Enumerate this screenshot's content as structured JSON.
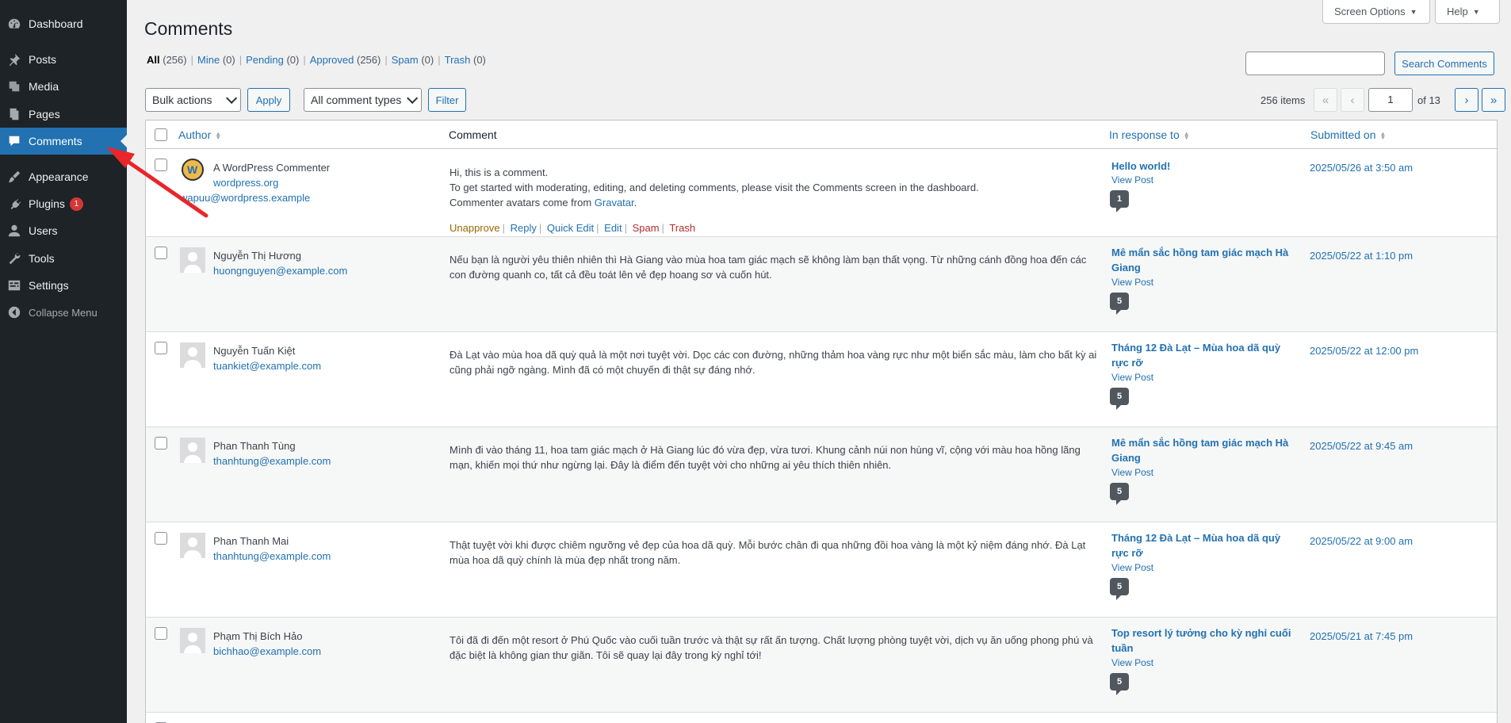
{
  "sidebar": {
    "items": [
      {
        "label": "Dashboard",
        "icon": "dashboard-icon"
      },
      {
        "label": "Posts",
        "icon": "pin-icon"
      },
      {
        "label": "Media",
        "icon": "media-icon"
      },
      {
        "label": "Pages",
        "icon": "pages-icon"
      },
      {
        "label": "Comments",
        "icon": "comment-bubble-icon",
        "active": true
      },
      {
        "label": "Appearance",
        "icon": "brush-icon"
      },
      {
        "label": "Plugins",
        "icon": "plug-icon",
        "badge": "1"
      },
      {
        "label": "Users",
        "icon": "user-icon"
      },
      {
        "label": "Tools",
        "icon": "wrench-icon"
      },
      {
        "label": "Settings",
        "icon": "settings-icon"
      },
      {
        "label": "Collapse Menu",
        "icon": "collapse-icon"
      }
    ]
  },
  "header": {
    "title": "Comments",
    "screen_options": "Screen Options",
    "help": "Help"
  },
  "filters": {
    "all_label": "All",
    "all_count": "(256)",
    "mine_label": "Mine",
    "mine_count": "(0)",
    "pending_label": "Pending",
    "pending_count": "(0)",
    "approved_label": "Approved",
    "approved_count": "(256)",
    "spam_label": "Spam",
    "spam_count": "(0)",
    "trash_label": "Trash",
    "trash_count": "(0)"
  },
  "search": {
    "value": "",
    "button": "Search Comments"
  },
  "bulk": {
    "selected": "Bulk actions",
    "apply": "Apply"
  },
  "types": {
    "selected": "All comment types",
    "filter": "Filter"
  },
  "pagination": {
    "items": "256 items",
    "first": "«",
    "prev": "‹",
    "next": "›",
    "last": "»",
    "current": "1",
    "of": "of 13"
  },
  "table": {
    "headers": {
      "author": "Author",
      "comment": "Comment",
      "response": "In response to",
      "submitted": "Submitted on"
    },
    "rows": [
      {
        "author": "A WordPress Commenter",
        "site": "wordpress.org",
        "email": "wapuu@wordpress.example",
        "lines": [
          "Hi, this is a comment.",
          "To get started with moderating, editing, and deleting comments, please visit the Comments screen in the dashboard."
        ],
        "line3_prefix": "Commenter avatars come from ",
        "line3_link": "Gravatar",
        "line3_suffix": ".",
        "actions": {
          "unapprove": "Unapprove",
          "reply": "Reply",
          "quick_edit": "Quick Edit",
          "edit": "Edit",
          "spam": "Spam",
          "trash": "Trash"
        },
        "response": "Hello world!",
        "view_post": "View Post",
        "count": "1",
        "submitted": "2025/05/26 at 3:50 am"
      },
      {
        "author": "Nguyễn Thị Hương",
        "email": "huongnguyen@example.com",
        "text": "Nếu bạn là người yêu thiên nhiên thì Hà Giang vào mùa hoa tam giác mạch sẽ không làm bạn thất vọng. Từ những cánh đồng hoa đến các con đường quanh co, tất cả đều toát lên vẻ đẹp hoang sơ và cuốn hút.",
        "response": "Mê mẩn sắc hồng tam giác mạch Hà Giang",
        "view_post": "View Post",
        "count": "5",
        "submitted": "2025/05/22 at 1:10 pm"
      },
      {
        "author": "Nguyễn Tuấn Kiệt",
        "email": "tuankiet@example.com",
        "text": "Đà Lạt vào mùa hoa dã quỳ quả là một nơi tuyệt vời. Dọc các con đường, những thảm hoa vàng rực như một biển sắc màu, làm cho bất kỳ ai cũng phải ngỡ ngàng. Mình đã có một chuyến đi thật sự đáng nhớ.",
        "response": "Tháng 12 Đà Lạt – Mùa hoa dã quỳ rực rỡ",
        "view_post": "View Post",
        "count": "5",
        "submitted": "2025/05/22 at 12:00 pm"
      },
      {
        "author": "Phan Thanh Tùng",
        "email": "thanhtung@example.com",
        "text": "Mình đi vào tháng 11, hoa tam giác mạch ở Hà Giang lúc đó vừa đẹp, vừa tươi. Khung cảnh núi non hùng vĩ, cộng với màu hoa hồng lãng mạn, khiến mọi thứ như ngừng lại. Đây là điểm đến tuyệt vời cho những ai yêu thích thiên nhiên.",
        "response": "Mê mẩn sắc hồng tam giác mạch Hà Giang",
        "view_post": "View Post",
        "count": "5",
        "submitted": "2025/05/22 at 9:45 am"
      },
      {
        "author": "Phan Thanh Mai",
        "email": "thanhtung@example.com",
        "text": "Thật tuyệt vời khi được chiêm ngưỡng vẻ đẹp của hoa dã quỳ. Mỗi bước chân đi qua những đồi hoa vàng là một kỷ niệm đáng nhớ. Đà Lạt mùa hoa dã quỳ chính là mùa đẹp nhất trong năm.",
        "response": "Tháng 12 Đà Lạt – Mùa hoa dã quỳ rực rỡ",
        "view_post": "View Post",
        "count": "5",
        "submitted": "2025/05/22 at 9:00 am"
      },
      {
        "author": "Phạm Thị Bích Hảo",
        "email": "bichhao@example.com",
        "text": "Tôi đã đi đến một resort ở Phú Quốc vào cuối tuần trước và thật sự rất ấn tượng. Chất lượng phòng tuyệt vời, dịch vụ ăn uống phong phú và đặc biệt là không gian thư giãn. Tôi sẽ quay lại đây trong kỳ nghỉ tới!",
        "response": "Top resort lý tưởng cho kỳ nghỉ cuối tuần",
        "view_post": "View Post",
        "count": "5",
        "submitted": "2025/05/21 at 7:45 pm"
      }
    ]
  },
  "colors": {
    "sidebar_bg": "#1d2327",
    "accent": "#2271b1",
    "arrow": "#e8262b"
  }
}
